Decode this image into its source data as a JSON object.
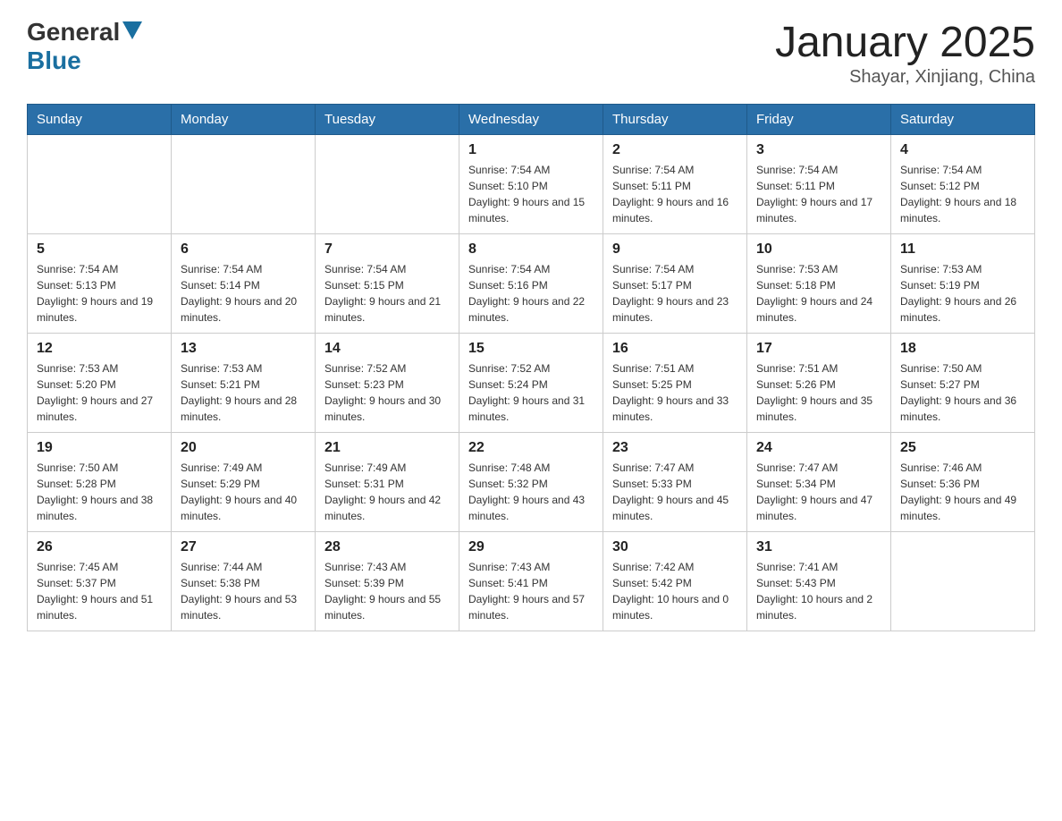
{
  "header": {
    "logo_general": "General",
    "logo_blue": "Blue",
    "month_title": "January 2025",
    "location": "Shayar, Xinjiang, China"
  },
  "days_of_week": [
    "Sunday",
    "Monday",
    "Tuesday",
    "Wednesday",
    "Thursday",
    "Friday",
    "Saturday"
  ],
  "weeks": [
    [
      {
        "day": "",
        "sunrise": "",
        "sunset": "",
        "daylight": ""
      },
      {
        "day": "",
        "sunrise": "",
        "sunset": "",
        "daylight": ""
      },
      {
        "day": "",
        "sunrise": "",
        "sunset": "",
        "daylight": ""
      },
      {
        "day": "1",
        "sunrise": "Sunrise: 7:54 AM",
        "sunset": "Sunset: 5:10 PM",
        "daylight": "Daylight: 9 hours and 15 minutes."
      },
      {
        "day": "2",
        "sunrise": "Sunrise: 7:54 AM",
        "sunset": "Sunset: 5:11 PM",
        "daylight": "Daylight: 9 hours and 16 minutes."
      },
      {
        "day": "3",
        "sunrise": "Sunrise: 7:54 AM",
        "sunset": "Sunset: 5:11 PM",
        "daylight": "Daylight: 9 hours and 17 minutes."
      },
      {
        "day": "4",
        "sunrise": "Sunrise: 7:54 AM",
        "sunset": "Sunset: 5:12 PM",
        "daylight": "Daylight: 9 hours and 18 minutes."
      }
    ],
    [
      {
        "day": "5",
        "sunrise": "Sunrise: 7:54 AM",
        "sunset": "Sunset: 5:13 PM",
        "daylight": "Daylight: 9 hours and 19 minutes."
      },
      {
        "day": "6",
        "sunrise": "Sunrise: 7:54 AM",
        "sunset": "Sunset: 5:14 PM",
        "daylight": "Daylight: 9 hours and 20 minutes."
      },
      {
        "day": "7",
        "sunrise": "Sunrise: 7:54 AM",
        "sunset": "Sunset: 5:15 PM",
        "daylight": "Daylight: 9 hours and 21 minutes."
      },
      {
        "day": "8",
        "sunrise": "Sunrise: 7:54 AM",
        "sunset": "Sunset: 5:16 PM",
        "daylight": "Daylight: 9 hours and 22 minutes."
      },
      {
        "day": "9",
        "sunrise": "Sunrise: 7:54 AM",
        "sunset": "Sunset: 5:17 PM",
        "daylight": "Daylight: 9 hours and 23 minutes."
      },
      {
        "day": "10",
        "sunrise": "Sunrise: 7:53 AM",
        "sunset": "Sunset: 5:18 PM",
        "daylight": "Daylight: 9 hours and 24 minutes."
      },
      {
        "day": "11",
        "sunrise": "Sunrise: 7:53 AM",
        "sunset": "Sunset: 5:19 PM",
        "daylight": "Daylight: 9 hours and 26 minutes."
      }
    ],
    [
      {
        "day": "12",
        "sunrise": "Sunrise: 7:53 AM",
        "sunset": "Sunset: 5:20 PM",
        "daylight": "Daylight: 9 hours and 27 minutes."
      },
      {
        "day": "13",
        "sunrise": "Sunrise: 7:53 AM",
        "sunset": "Sunset: 5:21 PM",
        "daylight": "Daylight: 9 hours and 28 minutes."
      },
      {
        "day": "14",
        "sunrise": "Sunrise: 7:52 AM",
        "sunset": "Sunset: 5:23 PM",
        "daylight": "Daylight: 9 hours and 30 minutes."
      },
      {
        "day": "15",
        "sunrise": "Sunrise: 7:52 AM",
        "sunset": "Sunset: 5:24 PM",
        "daylight": "Daylight: 9 hours and 31 minutes."
      },
      {
        "day": "16",
        "sunrise": "Sunrise: 7:51 AM",
        "sunset": "Sunset: 5:25 PM",
        "daylight": "Daylight: 9 hours and 33 minutes."
      },
      {
        "day": "17",
        "sunrise": "Sunrise: 7:51 AM",
        "sunset": "Sunset: 5:26 PM",
        "daylight": "Daylight: 9 hours and 35 minutes."
      },
      {
        "day": "18",
        "sunrise": "Sunrise: 7:50 AM",
        "sunset": "Sunset: 5:27 PM",
        "daylight": "Daylight: 9 hours and 36 minutes."
      }
    ],
    [
      {
        "day": "19",
        "sunrise": "Sunrise: 7:50 AM",
        "sunset": "Sunset: 5:28 PM",
        "daylight": "Daylight: 9 hours and 38 minutes."
      },
      {
        "day": "20",
        "sunrise": "Sunrise: 7:49 AM",
        "sunset": "Sunset: 5:29 PM",
        "daylight": "Daylight: 9 hours and 40 minutes."
      },
      {
        "day": "21",
        "sunrise": "Sunrise: 7:49 AM",
        "sunset": "Sunset: 5:31 PM",
        "daylight": "Daylight: 9 hours and 42 minutes."
      },
      {
        "day": "22",
        "sunrise": "Sunrise: 7:48 AM",
        "sunset": "Sunset: 5:32 PM",
        "daylight": "Daylight: 9 hours and 43 minutes."
      },
      {
        "day": "23",
        "sunrise": "Sunrise: 7:47 AM",
        "sunset": "Sunset: 5:33 PM",
        "daylight": "Daylight: 9 hours and 45 minutes."
      },
      {
        "day": "24",
        "sunrise": "Sunrise: 7:47 AM",
        "sunset": "Sunset: 5:34 PM",
        "daylight": "Daylight: 9 hours and 47 minutes."
      },
      {
        "day": "25",
        "sunrise": "Sunrise: 7:46 AM",
        "sunset": "Sunset: 5:36 PM",
        "daylight": "Daylight: 9 hours and 49 minutes."
      }
    ],
    [
      {
        "day": "26",
        "sunrise": "Sunrise: 7:45 AM",
        "sunset": "Sunset: 5:37 PM",
        "daylight": "Daylight: 9 hours and 51 minutes."
      },
      {
        "day": "27",
        "sunrise": "Sunrise: 7:44 AM",
        "sunset": "Sunset: 5:38 PM",
        "daylight": "Daylight: 9 hours and 53 minutes."
      },
      {
        "day": "28",
        "sunrise": "Sunrise: 7:43 AM",
        "sunset": "Sunset: 5:39 PM",
        "daylight": "Daylight: 9 hours and 55 minutes."
      },
      {
        "day": "29",
        "sunrise": "Sunrise: 7:43 AM",
        "sunset": "Sunset: 5:41 PM",
        "daylight": "Daylight: 9 hours and 57 minutes."
      },
      {
        "day": "30",
        "sunrise": "Sunrise: 7:42 AM",
        "sunset": "Sunset: 5:42 PM",
        "daylight": "Daylight: 10 hours and 0 minutes."
      },
      {
        "day": "31",
        "sunrise": "Sunrise: 7:41 AM",
        "sunset": "Sunset: 5:43 PM",
        "daylight": "Daylight: 10 hours and 2 minutes."
      },
      {
        "day": "",
        "sunrise": "",
        "sunset": "",
        "daylight": ""
      }
    ]
  ]
}
